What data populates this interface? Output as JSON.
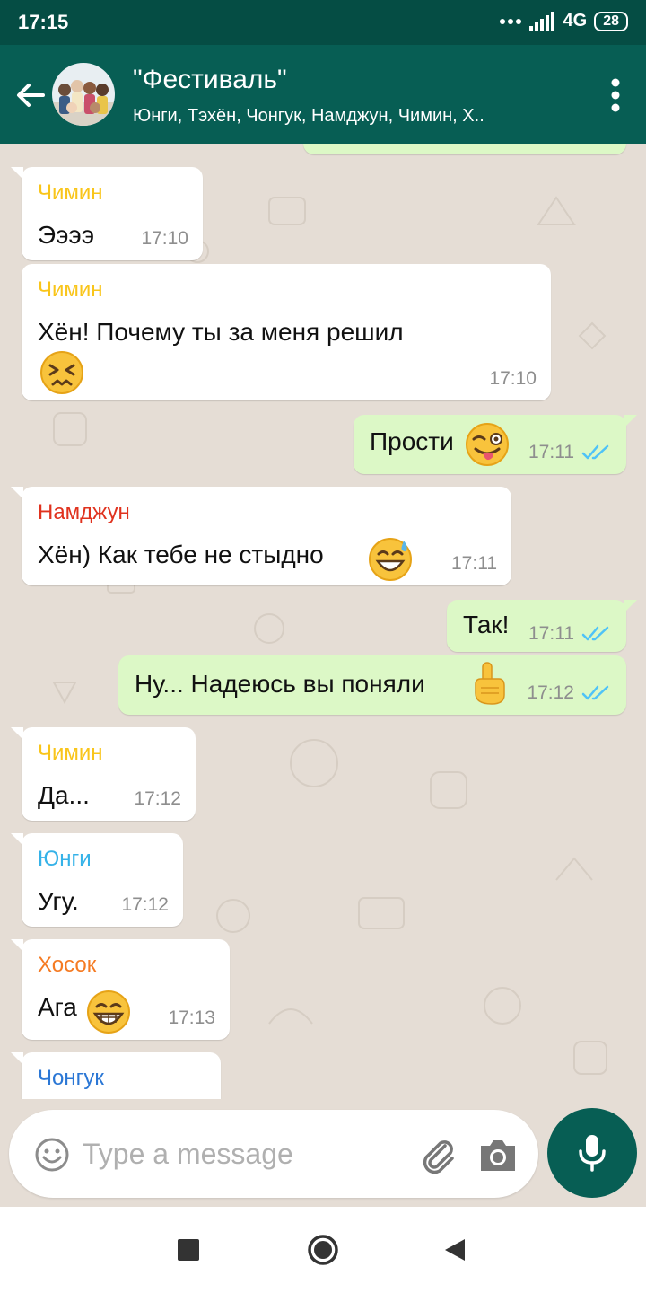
{
  "status_bar": {
    "time": "17:15",
    "network": "4G",
    "battery": "28"
  },
  "header": {
    "title": "\"Фестиваль\"",
    "members": "Юнги, Тэхён, Чонгук, Намджун, Чимин, Х..",
    "icons": {
      "back": "arrow-left-icon",
      "menu": "more-vertical-icon"
    }
  },
  "messages": [
    {
      "sender": "Чимин",
      "text": "Ээээ",
      "time": "17:10",
      "direction": "in",
      "sender_color": "#f9c51a"
    },
    {
      "sender": "Чимин",
      "text": "Хён! Почему ты за меня решил",
      "emoji": "confounded-face",
      "time": "17:10",
      "direction": "in",
      "sender_color": "#f9c51a"
    },
    {
      "text": "Прости",
      "emoji": "winking-face-with-tongue",
      "time": "17:11",
      "direction": "out",
      "status": "read"
    },
    {
      "sender": "Намджун",
      "text": "Хён) Как тебе не стыдно",
      "emoji": "grinning-face-with-sweat",
      "time": "17:11",
      "direction": "in",
      "sender_color": "#e0321e"
    },
    {
      "text": "Так!",
      "time": "17:11",
      "direction": "out",
      "status": "read"
    },
    {
      "text": "Ну... Надеюсь вы поняли",
      "emoji": "index-pointing-up",
      "time": "17:12",
      "direction": "out",
      "status": "read"
    },
    {
      "sender": "Чимин",
      "text": "Да...",
      "time": "17:12",
      "direction": "in",
      "sender_color": "#f9c51a"
    },
    {
      "sender": "Юнги",
      "text": "Угу.",
      "time": "17:12",
      "direction": "in",
      "sender_color": "#35b2e8"
    },
    {
      "sender": "Хосок",
      "text": "Ага",
      "emoji": "beaming-face",
      "time": "17:13",
      "direction": "in",
      "sender_color": "#f57b23"
    },
    {
      "sender": "Чонгук",
      "direction": "in",
      "sender_color": "#2b77d5"
    }
  ],
  "input": {
    "placeholder": "Type a message"
  },
  "colors": {
    "header": "#075e54",
    "chat_bg": "#e5ddd5",
    "outgoing": "#dcf8c6",
    "incoming": "#ffffff",
    "read_ticks": "#4fc3f7"
  }
}
